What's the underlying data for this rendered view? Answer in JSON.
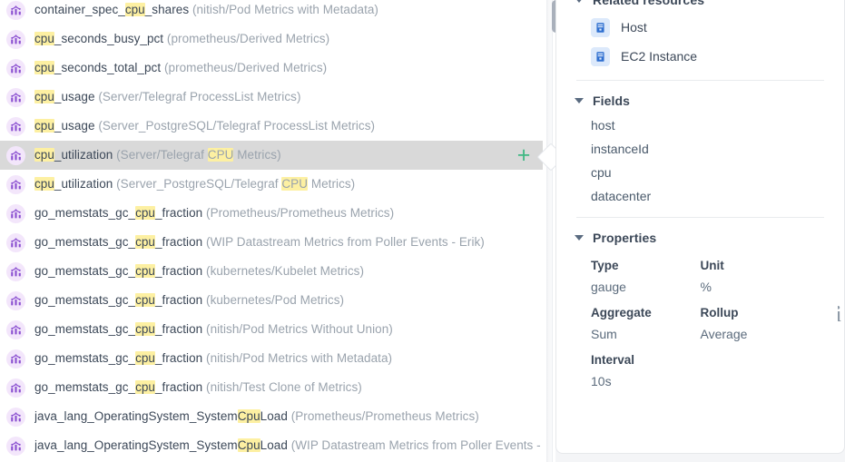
{
  "search_term": "cpu",
  "colors": {
    "highlight": "#fdf0a2",
    "add_accent": "#3fb883",
    "metric_icon_bg": "#f3e6fb",
    "metric_icon_fg": "#8a4fd0",
    "resource_icon_bg": "#dce9fb",
    "resource_icon_fg": "#2f6fd0",
    "selected_row_bg": "#d9d9d9",
    "text_primary": "#3c4858",
    "text_muted": "#9aa3ad"
  },
  "results": {
    "icon_name": "metric-chart-icon",
    "add_button_label": "+",
    "rows": [
      {
        "name_pre": "container_spec_",
        "name_hl": "cpu",
        "name_post": "_shares",
        "source_pre": "(nitish/Pod Metrics with Metadata)",
        "source_hl": "",
        "source_post": "",
        "selected": false
      },
      {
        "name_pre": "",
        "name_hl": "cpu",
        "name_post": "_seconds_busy_pct",
        "source_pre": "(prometheus/Derived Metrics)",
        "source_hl": "",
        "source_post": "",
        "selected": false
      },
      {
        "name_pre": "",
        "name_hl": "cpu",
        "name_post": "_seconds_total_pct",
        "source_pre": "(prometheus/Derived Metrics)",
        "source_hl": "",
        "source_post": "",
        "selected": false
      },
      {
        "name_pre": "",
        "name_hl": "cpu",
        "name_post": "_usage",
        "source_pre": "(Server/Telegraf ProcessList Metrics)",
        "source_hl": "",
        "source_post": "",
        "selected": false
      },
      {
        "name_pre": "",
        "name_hl": "cpu",
        "name_post": "_usage",
        "source_pre": "(Server_PostgreSQL/Telegraf ProcessList Metrics)",
        "source_hl": "",
        "source_post": "",
        "selected": false
      },
      {
        "name_pre": "",
        "name_hl": "cpu",
        "name_post": "_utilization",
        "source_pre": "(Server/Telegraf ",
        "source_hl": "CPU",
        "source_post": " Metrics)",
        "selected": true
      },
      {
        "name_pre": "",
        "name_hl": "cpu",
        "name_post": "_utilization",
        "source_pre": "(Server_PostgreSQL/Telegraf ",
        "source_hl": "CPU",
        "source_post": " Metrics)",
        "selected": false
      },
      {
        "name_pre": "go_memstats_gc_",
        "name_hl": "cpu",
        "name_post": "_fraction",
        "source_pre": "(Prometheus/Prometheus Metrics)",
        "source_hl": "",
        "source_post": "",
        "selected": false
      },
      {
        "name_pre": "go_memstats_gc_",
        "name_hl": "cpu",
        "name_post": "_fraction",
        "source_pre": "(WIP Datastream Metrics from Poller Events - Erik)",
        "source_hl": "",
        "source_post": "",
        "selected": false
      },
      {
        "name_pre": "go_memstats_gc_",
        "name_hl": "cpu",
        "name_post": "_fraction",
        "source_pre": "(kubernetes/Kubelet Metrics)",
        "source_hl": "",
        "source_post": "",
        "selected": false
      },
      {
        "name_pre": "go_memstats_gc_",
        "name_hl": "cpu",
        "name_post": "_fraction",
        "source_pre": "(kubernetes/Pod Metrics)",
        "source_hl": "",
        "source_post": "",
        "selected": false
      },
      {
        "name_pre": "go_memstats_gc_",
        "name_hl": "cpu",
        "name_post": "_fraction",
        "source_pre": "(nitish/Pod Metrics Without Union)",
        "source_hl": "",
        "source_post": "",
        "selected": false
      },
      {
        "name_pre": "go_memstats_gc_",
        "name_hl": "cpu",
        "name_post": "_fraction",
        "source_pre": "(nitish/Pod Metrics with Metadata)",
        "source_hl": "",
        "source_post": "",
        "selected": false
      },
      {
        "name_pre": "go_memstats_gc_",
        "name_hl": "cpu",
        "name_post": "_fraction",
        "source_pre": "(nitish/Test Clone of Metrics)",
        "source_hl": "",
        "source_post": "",
        "selected": false
      },
      {
        "name_pre": "java_lang_OperatingSystem_System",
        "name_hl": "Cpu",
        "name_post": "Load",
        "source_pre": "(Prometheus/Prometheus Metrics)",
        "source_hl": "",
        "source_post": "",
        "selected": false
      },
      {
        "name_pre": "java_lang_OperatingSystem_System",
        "name_hl": "Cpu",
        "name_post": "Load",
        "source_pre": "(WIP Datastream Metrics from Poller Events - …",
        "source_hl": "",
        "source_post": "",
        "selected": false
      }
    ]
  },
  "details": {
    "related_resources": {
      "title": "Related resources",
      "items": [
        {
          "label": "Host",
          "icon": "server-icon"
        },
        {
          "label": "EC2 Instance",
          "icon": "server-icon"
        }
      ]
    },
    "fields": {
      "title": "Fields",
      "items": [
        "host",
        "instanceId",
        "cpu",
        "datacenter"
      ]
    },
    "properties": {
      "title": "Properties",
      "pairs": [
        [
          {
            "label": "Type",
            "value": "gauge"
          },
          {
            "label": "Unit",
            "value": "%"
          }
        ],
        [
          {
            "label": "Aggregate",
            "value": "Sum"
          },
          {
            "label": "Rollup",
            "value": "Average"
          }
        ],
        [
          {
            "label": "Interval",
            "value": "10s"
          },
          {
            "label": "",
            "value": ""
          }
        ]
      ]
    }
  },
  "edge_info_glyph": "i"
}
